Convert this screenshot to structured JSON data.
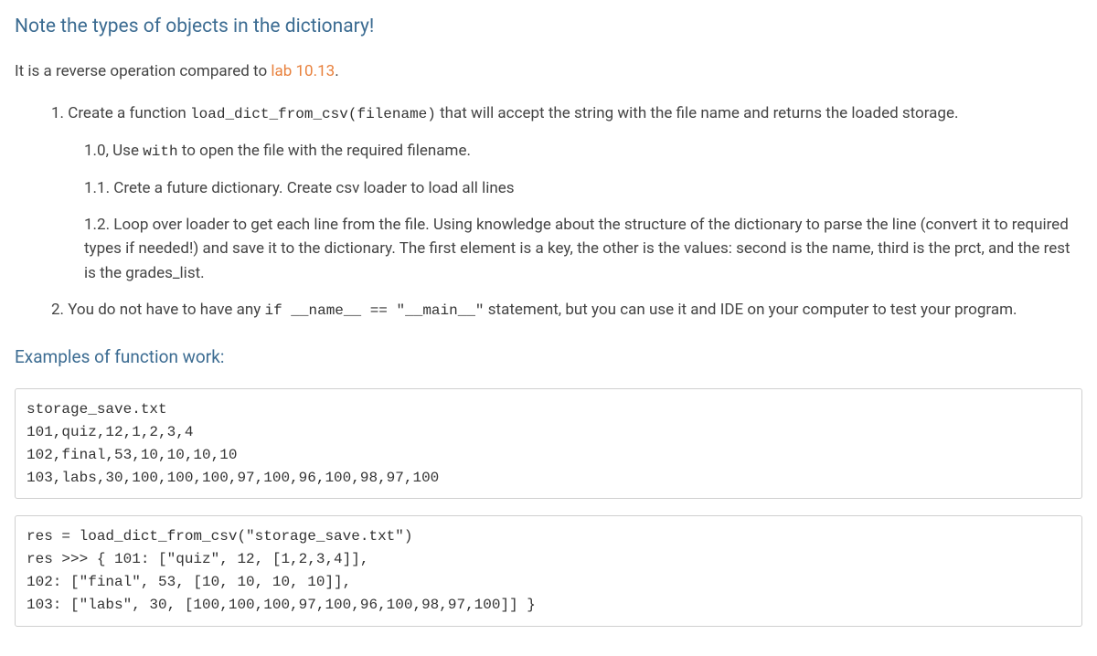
{
  "heading": "Note the types of objects in the dictionary!",
  "intro_prefix": "It is a reverse operation compared to ",
  "intro_link": "lab 10.13",
  "intro_suffix": ".",
  "item1": {
    "num": "1. ",
    "t1": "Create a function ",
    "code": "load_dict_from_csv(filename)",
    "t2": " that will accept the string with the file name and returns the loaded storage.",
    "sub": [
      {
        "num": "1.0, ",
        "t1": "Use ",
        "code": "with",
        "t2": " to open the file with the required filename."
      },
      {
        "num": "1.1. ",
        "text": "Crete a future dictionary. Create csv loader to load all lines"
      },
      {
        "num": "1.2. ",
        "text": "Loop over loader to get each line from the file. Using knowledge about the structure of the dictionary to parse the line (convert it to required types if needed!) and save it to the dictionary. The first element is a key, the other is the values: second is the name, third is the prct, and the rest is the grades_list."
      }
    ]
  },
  "item2": {
    "num": "2. ",
    "t1": "You do not have to have any ",
    "code": "if __name__ == \"__main__\"",
    "t2": " statement, but you can use it and IDE on your computer to test your program."
  },
  "examples_heading": "Examples of function work:",
  "codeblock1": "storage_save.txt\n101,quiz,12,1,2,3,4\n102,final,53,10,10,10,10\n103,labs,30,100,100,100,97,100,96,100,98,97,100",
  "codeblock2": "res = load_dict_from_csv(\"storage_save.txt\")\nres >>> { 101: [\"quiz\", 12, [1,2,3,4]],\n102: [\"final\", 53, [10, 10, 10, 10]],\n103: [\"labs\", 30, [100,100,100,97,100,96,100,98,97,100]] }"
}
